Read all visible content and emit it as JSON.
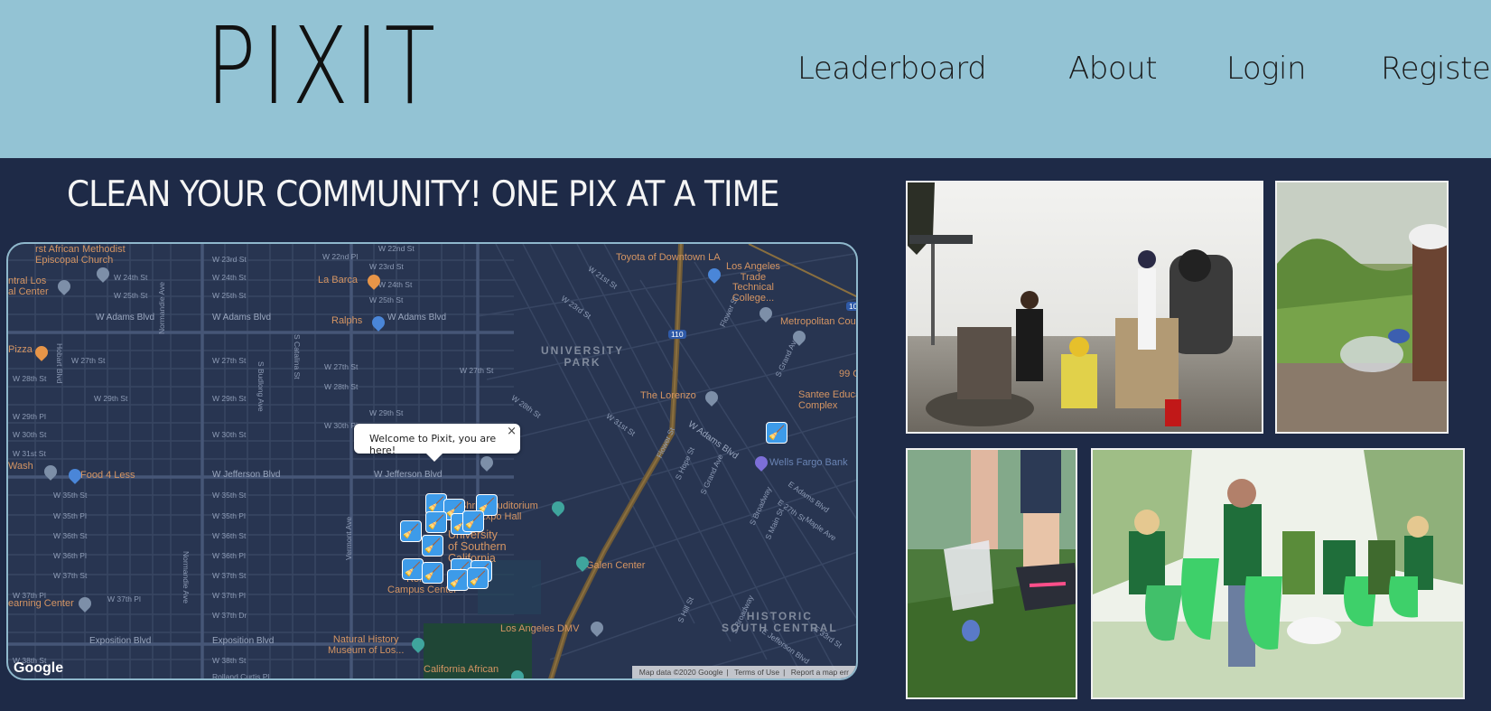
{
  "header": {
    "logo": "PIXIT",
    "nav": {
      "leaderboard": "Leaderboard",
      "about": "About",
      "login": "Login",
      "register": "Register"
    }
  },
  "hero": {
    "headline": "CLEAN YOUR COMMUNITY! ONE PIX AT A TIME"
  },
  "map": {
    "popup_text": "Welcome to Pixit, you are here!",
    "popup_close": "×",
    "google_logo": "Google",
    "attribution": {
      "map_data": "Map data ©2020 Google",
      "terms": "Terms of Use",
      "report": "Report a map err"
    },
    "streets": {
      "w23": "W 23rd St",
      "w24": "W 24th St",
      "w25": "W 25th St",
      "wadams1": "W Adams Blvd",
      "wadams2": "W Adams Blvd",
      "w27": "W 27th St",
      "w27b": "W 27th St",
      "w28": "W 28th St",
      "w28b": "W 28th St",
      "w29": "W 29th St",
      "w29b": "W 29th St",
      "w29pl": "W 29th Pl",
      "w30": "W 30th St",
      "w30b": "W 30th St",
      "w31": "W 31st St",
      "wjeff": "W Jefferson Blvd",
      "wjeff2": "W Jefferson Blvd",
      "w35": "W 35th St",
      "w35b": "W 35th St",
      "w35pl": "W 35th Pl",
      "w35plb": "W 35th Pl",
      "w36": "W 36th St",
      "w36b": "W 36th St",
      "w36pl": "W 36th Pl",
      "w36plb": "W 36th Pl",
      "w37": "W 37th St",
      "w37b": "W 37th St",
      "w37pl": "W 37th Pl",
      "w37plb": "W 37th Pl",
      "w37dr": "W 37th Dr",
      "w38": "W 38th St",
      "w38b": "W 38th St",
      "expo": "Exposition Blvd",
      "expo2": "Exposition Blvd",
      "normandie": "Normandie Ave",
      "normandie2": "Normandie Ave",
      "vermont": "Vermont Ave",
      "hobart": "Hobart Blvd",
      "w22pl": "W 22nd Pl",
      "w22": "W 22nd St",
      "w23b": "W 23rd St",
      "w24b": "W 24th St",
      "w25b": "W 25th St",
      "w27pl": "W 27th St",
      "w30pl": "W 30th Pl",
      "sbudlong": "S Budlong Ave",
      "scatalina": "S Catalina St",
      "w21": "W 21st St",
      "w23c": "W 23rd St",
      "w24c": "W 24th St",
      "w28c": "W 28th St",
      "w27c": "W 27th St",
      "wadams3": "W Adams Blvd",
      "flower": "Flower St",
      "sgrand": "S Grand Ave",
      "eadams": "E Adams Blvd",
      "e27": "E 27th St",
      "e28": "E 28th St",
      "sbroadway": "S Broadway",
      "smain": "S Main St",
      "smaple": "Maple Ave",
      "shill": "S Hill St",
      "ejefferson": "E Jefferson Blvd",
      "e33": "E 33rd St",
      "e35": "E 35th St",
      "w31b": "W 31st St",
      "shope": "S Hope St",
      "w29c": "W 29th St",
      "w37pl2": "W 37th Pl",
      "rolland": "Rolland Curtis Pl",
      "sfigueroa": "S Figueroa St"
    },
    "places": {
      "african_methodist": "rst African Methodist\nEpiscopal Church",
      "central_los": "ntral Los\nal Center",
      "pizza": "Pizza",
      "wash": "Wash",
      "learning_center": "earning Center",
      "la_barca": "La Barca",
      "ralphs": "Ralphs",
      "food4less": "Food 4 Less",
      "toyota": "Toyota of Downtown LA",
      "la_trade": "Los Angeles\nTrade\nTechnical\nCollege...",
      "metropolitan": "Metropolitan Cou",
      "the_lorenzo": "The Lorenzo",
      "santee": "Santee Educa\nComplex",
      "99c": "99 C",
      "wells_fargo": "Wells Fargo Bank",
      "shrine": "Shrine Auditorium\nand Expo Hall",
      "usc": "University\nof Southern\nCalifornia",
      "ronald": "Ronald\nCampus Center",
      "galen": "Galen Center",
      "la_dmv": "Los Angeles DMV",
      "natural_history": "Natural History\nMuseum of Los...",
      "california_african": "California African",
      "university_park": "UNIVERSITY\nPARK",
      "historic": "HISTORIC\nSOUTH CENTRAL",
      "i110": "110",
      "i10": "10"
    }
  },
  "colors": {
    "header_bg": "#93c3d4",
    "page_bg": "#1e2a47",
    "map_bg": "#283551",
    "marker": "#3d9be9"
  },
  "photos": {
    "p1": "beach-cleanup-volunteers",
    "p2": "hand-picking-litter-grass",
    "p3": "gloved-hand-picking-grass",
    "p4": "volunteers-green-bags"
  }
}
